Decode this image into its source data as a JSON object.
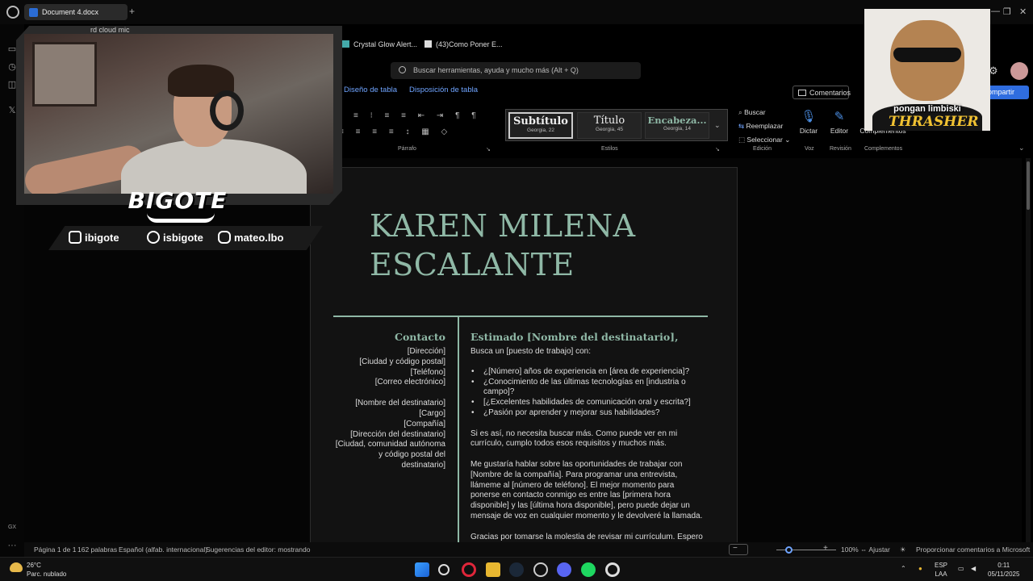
{
  "browser": {
    "tab_title": "Document 4.docx",
    "new_tab": "+",
    "partial_tab_text": "rd cloud mic",
    "bookmarks": [
      "Crystal Glow Alert...",
      "(43)Como Poner E..."
    ],
    "sidebar_bottom_label": "GX"
  },
  "word": {
    "search_placeholder": "Buscar herramientas, ayuda y mucho más (Alt + Q)",
    "ribbon_tabs": [
      "Diseño de tabla",
      "Disposición de tabla"
    ],
    "comments_label": "Comentarios",
    "share_label": "ompartir",
    "groups": {
      "paragraph": "Párrafo",
      "styles": "Estilos",
      "editing": "Edición",
      "voice": "Voz",
      "review": "Revisión",
      "addins": "Complementos"
    },
    "styles": [
      {
        "name": "Subtítulo",
        "font": "Georgia, 22"
      },
      {
        "name": "Título",
        "font": "Georgia, 45"
      },
      {
        "name": "Encabeza...",
        "font": "Georgia, 14"
      }
    ],
    "editing": {
      "find": "Buscar",
      "replace": "Reemplazar",
      "select": "Seleccionar"
    },
    "tools": {
      "dictate": "Dictar",
      "editor": "Editor",
      "addins": "Complementos"
    }
  },
  "document": {
    "name_line1": "KAREN MILENA",
    "name_line2": "ESCALANTE",
    "contact": {
      "title": "Contacto",
      "lines": [
        "[Dirección]",
        "[Ciudad y código postal]",
        "[Teléfono]",
        "[Correo electrónico]"
      ],
      "recipient_lines": [
        "[Nombre del destinatario]",
        "[Cargo]",
        "[Compañía]",
        "[Dirección del destinatario]",
        "[Ciudad, comunidad autónoma y código postal del destinatario]"
      ]
    },
    "letter": {
      "greeting": "Estimado [Nombre del destinatario],",
      "intro": "Busca un [puesto de trabajo] con:",
      "bullets": [
        "¿[Número] años de experiencia en [área de experiencia]?",
        "¿Conocimiento de las últimas tecnologías en [industria o campo]?",
        "[¿Excelentes habilidades de comunicación oral y escrita?]",
        "¿Pasión por aprender y mejorar sus habilidades?"
      ],
      "p1": "Si es así, no necesita buscar más. Como puede ver en mi currículo, cumplo todos esos requisitos y muchos más.",
      "p2": "Me gustaría hablar sobre las oportunidades de trabajar con [Nombre de la compañía]. Para programar una entrevista, llámeme al [número de teléfono]. El mejor momento para ponerse en contacto conmigo es entre las [primera hora disponible] y las [última hora disponible], pero puede dejar un mensaje de voz en cualquier momento y le devolveré la llamada.",
      "p3": "Gracias por tomarse la molestia de revisar mi currículum. Espero"
    }
  },
  "statusbar": {
    "page": "Página 1 de 1",
    "words": "162 palabras",
    "language": "Español (alfab. internacional)",
    "suggestions": "Sugerencias del editor: mostrando",
    "zoom_minus": "−",
    "zoom_plus": "+",
    "zoom": "100%",
    "fit": "Ajustar",
    "feedback": "Proporcionar comentarios a Microsoft",
    "zoom_level": 0.2
  },
  "taskbar": {
    "temperature": "26°C",
    "weather": "Parc. nublado",
    "lang_top": "ESP",
    "lang_bottom": "LAA",
    "time": "0:11",
    "date": "05/11/2025"
  },
  "overlay": {
    "brand": "BIGOTE",
    "socials": [
      "ibigote",
      "isbigote",
      "mateo.lbo"
    ],
    "caption": "pongan limbiski",
    "shirt_logo": "THRASHER"
  },
  "colors": {
    "accent_blue": "#2f6de0",
    "doc_accent": "#8fb8a6",
    "canvas": "#050505"
  }
}
